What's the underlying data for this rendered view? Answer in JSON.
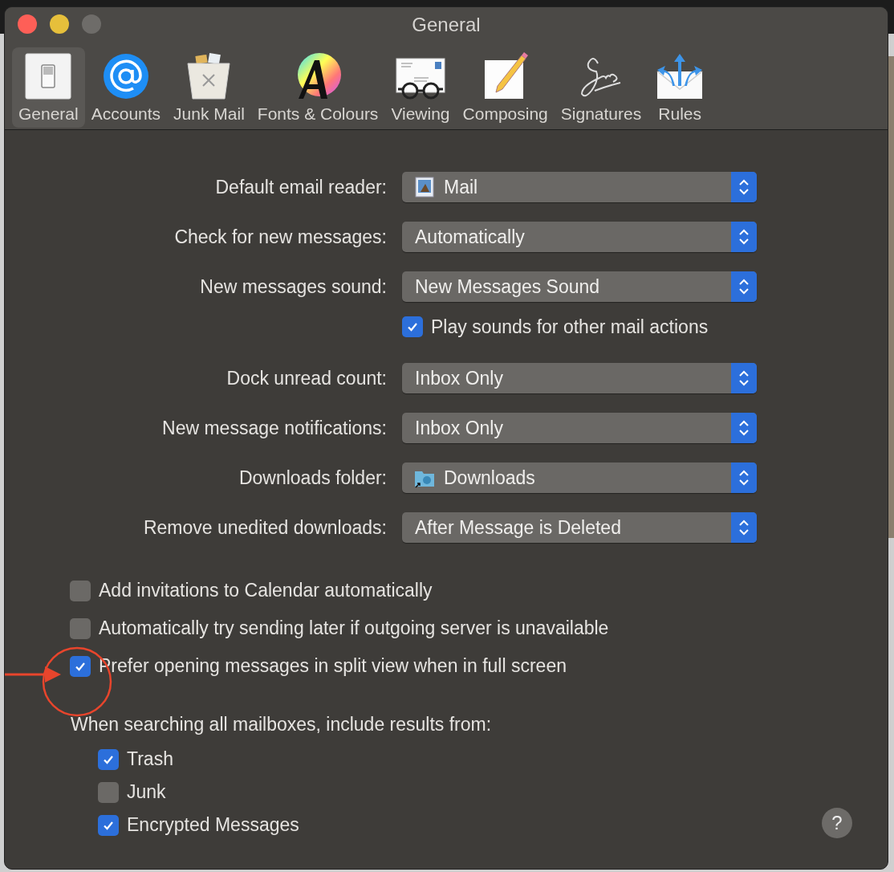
{
  "window": {
    "title": "General",
    "controls": [
      {
        "kind": "close"
      },
      {
        "kind": "minimize"
      },
      {
        "kind": "zoom"
      }
    ]
  },
  "toolbar": [
    {
      "label": "General",
      "kind": "general",
      "selected": true
    },
    {
      "label": "Accounts",
      "kind": "accounts",
      "selected": false
    },
    {
      "label": "Junk Mail",
      "kind": "junk",
      "selected": false
    },
    {
      "label": "Fonts & Colours",
      "kind": "fonts",
      "selected": false
    },
    {
      "label": "Viewing",
      "kind": "viewing",
      "selected": false
    },
    {
      "label": "Composing",
      "kind": "composing",
      "selected": false
    },
    {
      "label": "Signatures",
      "kind": "signatures",
      "selected": false
    },
    {
      "label": "Rules",
      "kind": "rules",
      "selected": false
    }
  ],
  "settings": [
    {
      "kind": "popup-app",
      "label": "Default email reader:",
      "value": "Mail"
    },
    {
      "kind": "popup",
      "label": "Check for new messages:",
      "value": "Automatically"
    },
    {
      "kind": "popup",
      "label": "New messages sound:",
      "value": "New Messages Sound"
    },
    {
      "kind": "checkbox",
      "label": "Play sounds for other mail actions",
      "checked": true
    },
    {
      "kind": "popup",
      "label": "Dock unread count:",
      "value": "Inbox Only"
    },
    {
      "kind": "popup",
      "label": "New message notifications:",
      "value": "Inbox Only"
    },
    {
      "kind": "popup-folder",
      "label": "Downloads folder:",
      "value": "Downloads"
    },
    {
      "kind": "popup",
      "label": "Remove unedited downloads:",
      "value": "After Message is Deleted"
    }
  ],
  "options": [
    {
      "label": "Add invitations to Calendar automatically",
      "checked": false
    },
    {
      "label": "Automatically try sending later if outgoing server is unavailable",
      "checked": false
    },
    {
      "label": "Prefer opening messages in split view when in full screen",
      "checked": true
    }
  ],
  "search": {
    "label": "When searching all mailboxes, include results from:",
    "items": [
      {
        "label": "Trash",
        "checked": true
      },
      {
        "label": "Junk",
        "checked": false
      },
      {
        "label": "Encrypted Messages",
        "checked": true
      }
    ]
  },
  "help": {
    "label": "?"
  }
}
